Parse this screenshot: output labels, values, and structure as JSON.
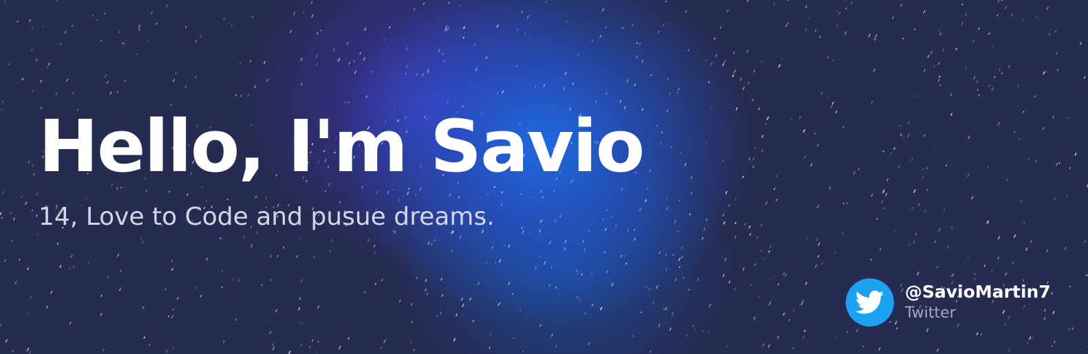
{
  "hero": {
    "headline": "Hello, I'm Savio",
    "tagline": "14, Love to Code and pusue dreams."
  },
  "social": {
    "handle": "@SavioMartin7",
    "platform": "Twitter",
    "icon": "twitter-bird-icon",
    "brand_color": "#1da1f2"
  },
  "theme": {
    "background": "#262b52",
    "glow_blue": "#1e6ee6",
    "glow_purple": "#4637be",
    "text_primary": "#ffffff",
    "text_secondary": "#d4d6e6"
  }
}
